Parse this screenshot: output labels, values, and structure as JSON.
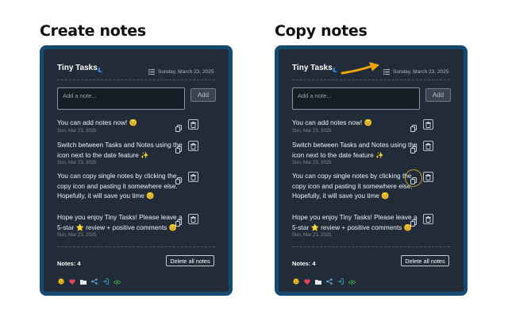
{
  "headings": {
    "left": "Create notes",
    "right": "Copy notes"
  },
  "panels": [
    {
      "id": "create",
      "title": "Tiny Tasks",
      "date": "Sunday, March 23, 2025",
      "input_placeholder": "Add a note...",
      "add_label": "Add",
      "notes": [
        {
          "text": "You can add notes now! 😊",
          "date": "Sun, Mar 23, 2025"
        },
        {
          "text": "Switch between Tasks and Notes using the icon next to the date feature ✨",
          "date": "Sun, Mar 23, 2025"
        },
        {
          "text": "You can copy single notes by clicking the copy icon and pasting it somewhere else. Hopefully, it will save you time 😊",
          "date": ""
        },
        {
          "text": "Hope you enjoy Tiny Tasks! Please leave a 5-star ⭐ review + positive comments 😊",
          "date": "Sun, Mar 23, 2025"
        }
      ],
      "notes_count": "Notes: 4",
      "delete_all_label": "Delete all notes"
    },
    {
      "id": "copy",
      "title": "Tiny Tasks",
      "date": "Sunday, March 23, 2025",
      "input_placeholder": "Add a note...",
      "add_label": "Add",
      "notes": [
        {
          "text": "You can add notes now! 😊",
          "date": "Sun, Mar 23, 2025"
        },
        {
          "text": "Switch between Tasks and Notes using the icon next to the date feature ✨",
          "date": "Sun, Mar 23, 2025"
        },
        {
          "text": "You can copy single notes by clicking the copy icon and pasting it somewhere else. Hopefully, it will save you time 😊",
          "date": ""
        },
        {
          "text": "Hope you enjoy Tiny Tasks! Please leave a 5-star ⭐ review + positive comments 😊",
          "date": "Sun, Mar 23, 2025"
        }
      ],
      "notes_count": "Notes: 4",
      "delete_all_label": "Delete all notes"
    }
  ],
  "icons": {
    "theme_toggle": "moon-icon",
    "view_switch": "list-icon",
    "copy": "copy-icon",
    "delete": "trash-icon",
    "footer": [
      "smile-icon",
      "heart-icon",
      "folder-icon",
      "share-icon",
      "sign-in-icon",
      "eye-icon"
    ]
  },
  "colors": {
    "panel_bg": "#222b38",
    "panel_border": "#174a70",
    "arrow": "#f0a500",
    "highlight_ring": "#c9a227"
  }
}
